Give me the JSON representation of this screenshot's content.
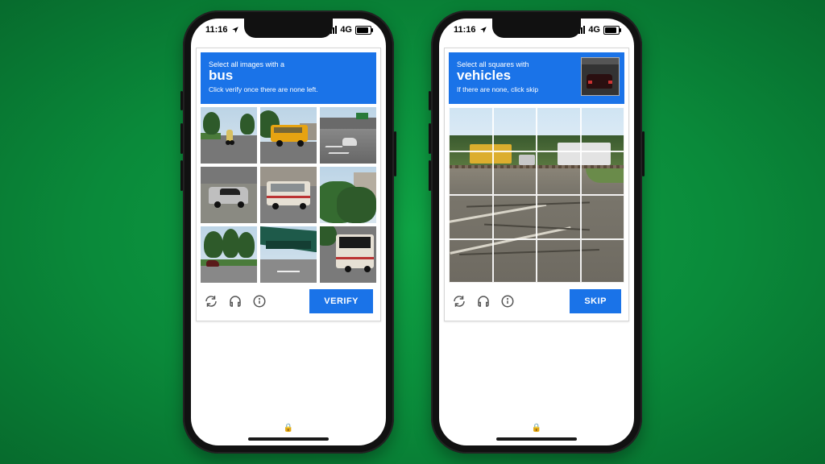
{
  "status": {
    "time": "11:16",
    "network_label": "4G"
  },
  "captcha_left": {
    "line1": "Select all images with a",
    "target": "bus",
    "line3": "Click verify once there are none left.",
    "action": "VERIFY",
    "tiles": [
      "street-cyclist",
      "school-bus",
      "highway-overpass",
      "silver-sedan",
      "white-city-bus",
      "green-bushes",
      "park-trees",
      "bridge-underside",
      "bus-rear"
    ]
  },
  "captcha_right": {
    "line1": "Select all squares with",
    "target": "vehicles",
    "line3": "If there are none, click skip",
    "action": "SKIP",
    "grid": 4
  },
  "icons": {
    "refresh": "refresh-icon",
    "audio": "headphones-icon",
    "info": "info-icon"
  }
}
